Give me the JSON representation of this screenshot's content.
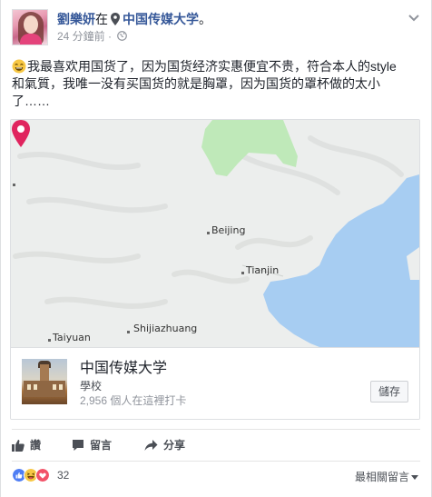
{
  "post": {
    "author": "劉樂妍",
    "at_word": "在",
    "place_inline": "中国传媒大学",
    "period": "。",
    "time": "24 分鐘前",
    "sep": "·",
    "text_line1": "我最喜欢用国货了，因为国货经济实惠便宜不贵，符合本人的style",
    "text_line2": "和氣質，我唯一没有买国货的就是胸罩，因为国货的罩杯做的太小",
    "text_line3": "了……"
  },
  "map": {
    "cities": {
      "beijing": "Beijing",
      "tianjin": "Tianjin",
      "shijiazhuang": "Shijiazhuang",
      "taiyuan": "Taiyuan"
    }
  },
  "place_card": {
    "name": "中国传媒大学",
    "category": "學校",
    "checkins": "2,956 個人在這裡打卡",
    "save_label": "儲存"
  },
  "actions": {
    "like": "讚",
    "comment": "留言",
    "share": "分享"
  },
  "reactions": {
    "count": "32",
    "sort_label": "最相關留言"
  },
  "colors": {
    "link": "#365899",
    "pin": "#e0245e",
    "water": "#a7cdf2",
    "park": "#bfe9b9"
  }
}
